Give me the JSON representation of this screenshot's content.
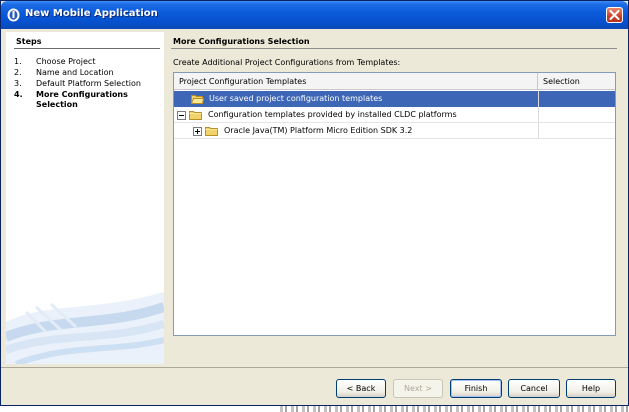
{
  "window": {
    "title": "New Mobile Application"
  },
  "steps": {
    "title": "Steps",
    "items": [
      {
        "num": "1.",
        "label": "Choose Project"
      },
      {
        "num": "2.",
        "label": "Name and Location"
      },
      {
        "num": "3.",
        "label": "Default Platform Selection"
      },
      {
        "num": "4.",
        "label": "More Configurations Selection"
      }
    ]
  },
  "main": {
    "title": "More Configurations Selection",
    "instruction": "Create Additional Project Configurations from Templates:",
    "table": {
      "headers": [
        "Project Configuration Templates",
        "Selection"
      ],
      "rows": [
        {
          "label": "User saved project configuration templates",
          "selected": true
        },
        {
          "label": "Configuration templates provided by installed CLDC platforms",
          "expanded": true
        },
        {
          "label": "Oracle Java(TM) Platform Micro Edition SDK 3.2",
          "expanded": false
        }
      ]
    }
  },
  "buttons": {
    "back": "< Back",
    "next": "Next >",
    "finish": "Finish",
    "cancel": "Cancel",
    "help": "Help"
  },
  "colors": {
    "selection": "#3d67b6",
    "titlebar": "#0a5ad8",
    "dialog_bg": "#ece9d8"
  }
}
